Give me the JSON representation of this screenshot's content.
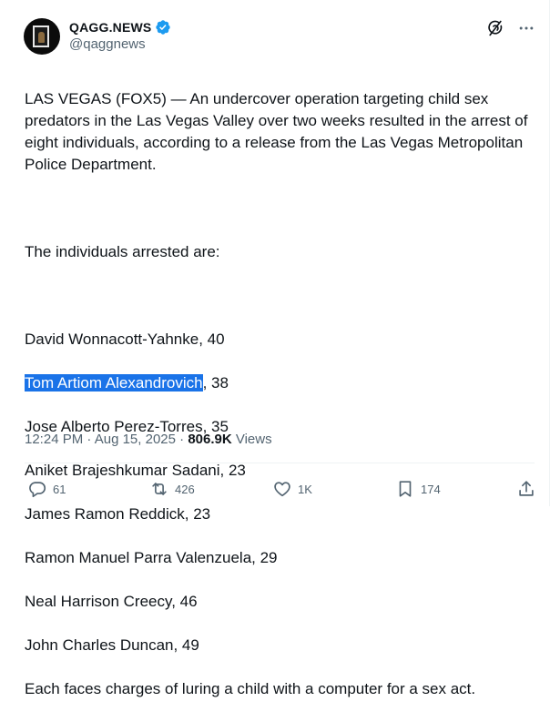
{
  "author": {
    "display_name": "Qagg.news",
    "handle": "@qaggnews",
    "verified_icon": "verified-badge-icon"
  },
  "top_actions": {
    "grok_icon": "grok-icon",
    "more_icon": "more-icon"
  },
  "tweet": {
    "intro": "LAS VEGAS (FOX5) — An undercover operation targeting child sex predators in the Las Vegas Valley over two weeks resulted in the arrest of eight individuals, according to a release from the Las Vegas Metropolitan Police Department.",
    "list_heading": "The individuals arrested are:",
    "arrested": [
      {
        "name": "David Wonnacott-Yahnke",
        "age_suffix": ", 40"
      },
      {
        "name": "Tom Artiom Alexandrovich",
        "age_suffix": ", 38",
        "selected": true
      },
      {
        "name": "Jose Alberto Perez-Torres",
        "age_suffix": ", 35"
      },
      {
        "name": "Aniket Brajeshkumar Sadani",
        "age_suffix": ", 23"
      },
      {
        "name": "James Ramon Reddick",
        "age_suffix": ", 23"
      },
      {
        "name": "Ramon Manuel Parra Valenzuela",
        "age_suffix": ", 29"
      },
      {
        "name": "Neal Harrison Creecy",
        "age_suffix": ", 46"
      },
      {
        "name": "John Charles Duncan",
        "age_suffix": ", 49"
      }
    ],
    "closing": "Each faces charges of luring a child with a computer for a sex act."
  },
  "meta": {
    "time": "12:24 PM",
    "sep": " · ",
    "date": "Aug 15, 2025",
    "views_count": "806.9K",
    "views_label": " Views"
  },
  "actions": {
    "replies": {
      "icon": "reply-icon",
      "count": "61"
    },
    "reposts": {
      "icon": "repost-icon",
      "count": "426"
    },
    "likes": {
      "icon": "like-icon",
      "count": "1K"
    },
    "bookmarks": {
      "icon": "bookmark-icon",
      "count": "174"
    },
    "share": {
      "icon": "share-icon"
    }
  },
  "colors": {
    "text": "#0f1419",
    "secondary": "#536471",
    "verified": "#1d9bf0",
    "selection": "#1a73e8"
  }
}
